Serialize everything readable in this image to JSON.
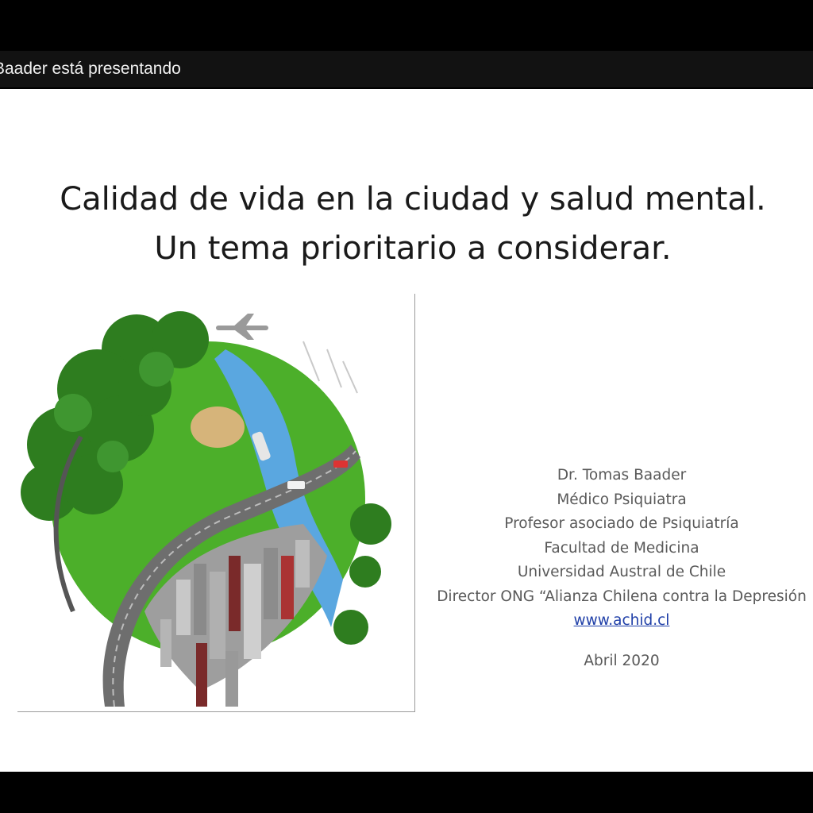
{
  "presenter_bar": {
    "text": "Baader está presentando"
  },
  "slide": {
    "title_line1": "Calidad de vida en la ciudad y salud mental.",
    "title_line2": "Un tema prioritario a considerar.",
    "image_alt": "globe-city-nature-illustration",
    "author": {
      "name": "Dr. Tomas Baader",
      "role": "Médico Psiquiatra",
      "position": "Profesor asociado de Psiquiatría",
      "faculty": "Facultad de Medicina",
      "university": "Universidad Austral de Chile",
      "director": "Director ONG “Alianza Chilena contra la Depresión",
      "website": "www.achid.cl",
      "date": "Abril 2020"
    }
  },
  "colors": {
    "grass": "#4caf2a",
    "trees": "#2e7d1f",
    "river": "#5aa7e0",
    "road": "#6e6e6e",
    "link": "#1f3fa8"
  }
}
